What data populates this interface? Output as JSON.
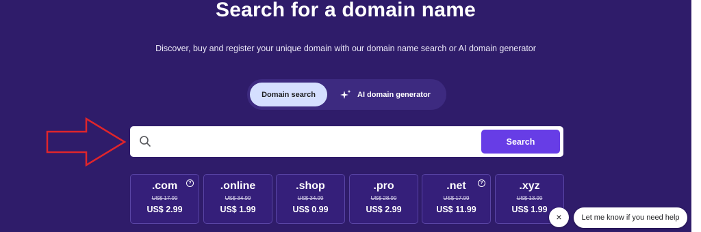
{
  "hero": {
    "title": "Search for a domain name",
    "subtitle": "Discover, buy and register your unique domain with our domain name search or AI domain generator"
  },
  "mode_toggle": {
    "domain_search": "Domain search",
    "ai_generator": "AI domain generator",
    "selected": "Domain search"
  },
  "search": {
    "value": "",
    "placeholder": "",
    "button_label": "Search"
  },
  "tlds": [
    {
      "name": ".com",
      "old_price": "US$ 17.99",
      "new_price": "US$ 2.99",
      "help_icon": true
    },
    {
      "name": ".online",
      "old_price": "US$ 34.99",
      "new_price": "US$ 1.99",
      "help_icon": false
    },
    {
      "name": ".shop",
      "old_price": "US$ 34.99",
      "new_price": "US$ 0.99",
      "help_icon": false
    },
    {
      "name": ".pro",
      "old_price": "US$ 28.99",
      "new_price": "US$ 2.99",
      "help_icon": false
    },
    {
      "name": ".net",
      "old_price": "US$ 17.99",
      "new_price": "US$ 11.99",
      "help_icon": true
    },
    {
      "name": ".xyz",
      "old_price": "US$ 13.99",
      "new_price": "US$ 1.99",
      "help_icon": false
    }
  ],
  "chat": {
    "close_symbol": "×",
    "message": "Let me know if you need help"
  },
  "colors": {
    "background": "#2f1c6a",
    "accent": "#673de6",
    "tab_selected": "#d5dfff",
    "annotation_arrow": "#e0252b"
  },
  "icons": {
    "search": "search-icon",
    "ai": "sparkle-icon",
    "help": "question-circle-icon",
    "annotation": "arrow-right-outline"
  }
}
